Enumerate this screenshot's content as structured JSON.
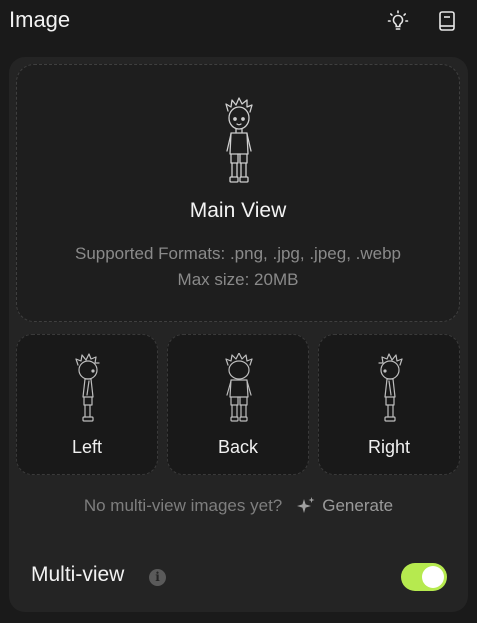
{
  "header": {
    "title": "Image",
    "icons": [
      "lightbulb-icon",
      "book-icon"
    ]
  },
  "main_view": {
    "label": "Main View",
    "formats_line": "Supported Formats: .png, .jpg, .jpeg, .webp",
    "size_line": "Max size: 20MB"
  },
  "views": [
    {
      "label": "Left"
    },
    {
      "label": "Back"
    },
    {
      "label": "Right"
    }
  ],
  "generate": {
    "prompt": "No multi-view images yet?",
    "link_label": "Generate"
  },
  "multiview": {
    "label": "Multi-view",
    "enabled": true
  },
  "colors": {
    "accent": "#b6ea4f",
    "background": "#1a1a1a",
    "panel": "#242424"
  }
}
